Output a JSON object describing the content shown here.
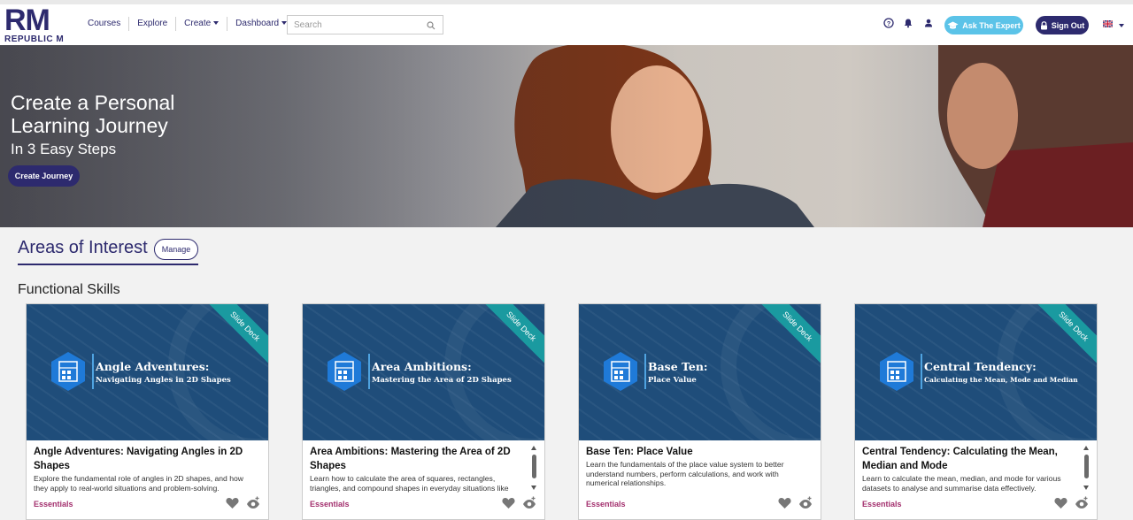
{
  "brand": {
    "mark": "RM",
    "name": "REPUBLIC M"
  },
  "nav": {
    "links": [
      "Courses",
      "Explore",
      "Create",
      "Dashboard"
    ],
    "search_placeholder": "Search",
    "ask_expert": "Ask The Expert",
    "sign_out": "Sign Out"
  },
  "hero": {
    "title": "Create a Personal Learning Journey",
    "subtitle": "In 3 Easy Steps",
    "button": "Create Journey"
  },
  "areas": {
    "title": "Areas of Interest",
    "manage": "Manage"
  },
  "section": {
    "title": "Functional Skills"
  },
  "cards": [
    {
      "ribbon": "Slide Deck",
      "thumb_title": "Angle Adventures:",
      "thumb_sub": "Navigating Angles in 2D Shapes",
      "title": "Angle Adventures: Navigating Angles in 2D Shapes",
      "desc": "Explore the fundamental role of angles in 2D shapes, and how they apply to real-world situations and problem-solving.",
      "tag": "Essentials"
    },
    {
      "ribbon": "Slide Deck",
      "thumb_title": "Area Ambitions:",
      "thumb_sub": "Mastering the Area of 2D Shapes",
      "title": "Area Ambitions: Mastering the Area of 2D Shapes",
      "desc": "Learn how to calculate the area of squares, rectangles, triangles, and compound shapes in everyday situations like home renovation and gardening.",
      "tag": "Essentials"
    },
    {
      "ribbon": "Slide Deck",
      "thumb_title": "Base Ten:",
      "thumb_sub": "Place Value",
      "title": "Base Ten: Place Value",
      "desc": "Learn the fundamentals of the place value system to better understand numbers, perform calculations, and work with numerical relationships.",
      "tag": "Essentials"
    },
    {
      "ribbon": "Slide Deck",
      "thumb_title": "Central Tendency:",
      "thumb_sub": "Calculating the Mean, Mode and Median",
      "title": "Central Tendency: Calculating the Mean, Median and Mode",
      "desc": "Learn to calculate the mean, median, and mode for various datasets to analyse and summarise data effectively.",
      "tag": "Essentials"
    }
  ],
  "colors": {
    "brand": "#2d2a6e",
    "accent": "#5bc3e8",
    "ribbon": "#1a9aa0",
    "tag": "#a3306e"
  }
}
